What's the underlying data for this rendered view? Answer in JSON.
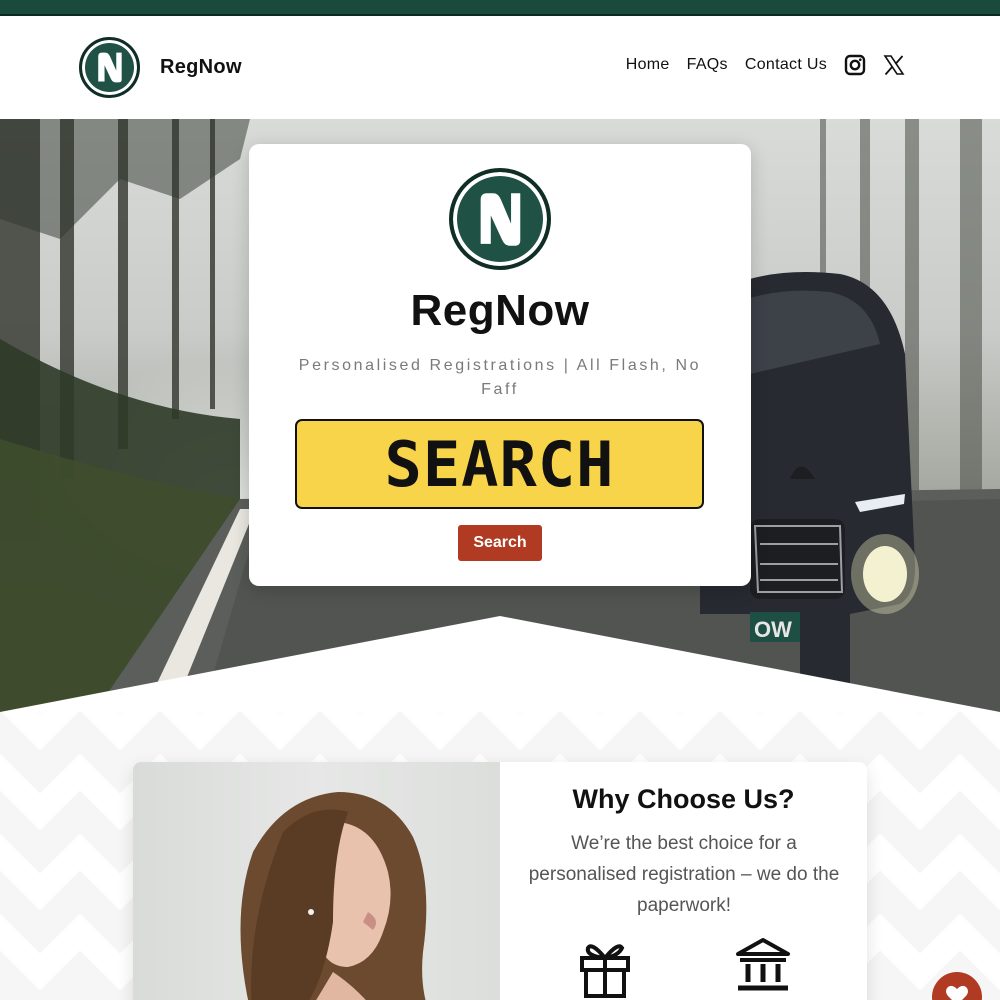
{
  "header": {
    "brand": "RegNow",
    "nav": [
      "Home",
      "FAQs",
      "Contact Us"
    ],
    "icons": [
      "instagram-icon",
      "x-twitter-icon"
    ]
  },
  "hero": {
    "title": "RegNow",
    "tagline": "Personalised Registrations | All Flash, No Faff",
    "plate_placeholder": "SEARCH",
    "search_button": "Search",
    "car_plate_fragment": "OW"
  },
  "why": {
    "title": "Why Choose Us?",
    "text": "We’re the best choice for a personalised registration – we do the paperwork!",
    "icons": [
      "gift-icon",
      "bank-icon"
    ]
  },
  "colors": {
    "brand_green": "#1f5245",
    "accent_red": "#b13b22",
    "plate_yellow": "#f7d44a"
  }
}
